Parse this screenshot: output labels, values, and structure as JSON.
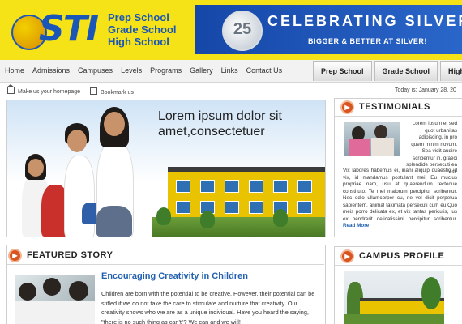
{
  "header": {
    "logo_text": "STI",
    "schools": [
      "Prep School",
      "Grade School",
      "High School"
    ],
    "banner_title": "CELEBRATING SILVER",
    "banner_subtitle": "BIGGER & BETTER AT SILVER!",
    "seal_number": "25"
  },
  "nav": {
    "links": [
      "Home",
      "Admissions",
      "Campuses",
      "Levels",
      "Programs",
      "Gallery",
      "Links",
      "Contact Us"
    ],
    "tabs": [
      "Prep School",
      "Grade School",
      "High Scho"
    ]
  },
  "utility": {
    "homepage": "Make us your homepage",
    "bookmark": "Bookmark us",
    "date": "Today is: January 28, 20"
  },
  "hero": {
    "text": "Lorem ipsum dolor sit amet,consectetuer"
  },
  "featured": {
    "section_title": "FEATURED STORY",
    "title": "Encouraging Creativity in Children",
    "body": "Children are born with the potential to be creative. However, their potential can be stifled if we do not take the care to stimulate and nurture that creativity. Our creativity shows who we are as a unique individual. Have you heard the saying, \"there is no such thing as can't\"? We can and we will!"
  },
  "testimonials": {
    "section_title": "TESTIMONIALS",
    "text_first": "Lorem ipsum et sed quot urbanitas adipiscing, in pro quem minim novum. Sea vidit audire scribentur in, graeci splendide persecuti ea est.",
    "text_rest": "Vix labores habemus ei, inani aliquip quaestio id vix, id mandamus postulant mei. Eu mucius propriae nam, usu at quaerendum recteque constituto. Te mei maiorum percipitur scribentur. Nec odio ullamcorper cu, ne vel dicit perpetua sapientem, animal takimata persecuti cum eu.Quo meis porro delicata ex, et vix tantas periculis, ius ex hendrerit delicatissimi percipitur scribentur.",
    "read_more": "Read More"
  },
  "campus": {
    "section_title": "CAMPUS PROFILE"
  },
  "colors": {
    "header_yellow": "#f5e318",
    "brand_blue": "#1a56b8",
    "accent_orange": "#d9541f",
    "link_blue": "#2361b0"
  }
}
